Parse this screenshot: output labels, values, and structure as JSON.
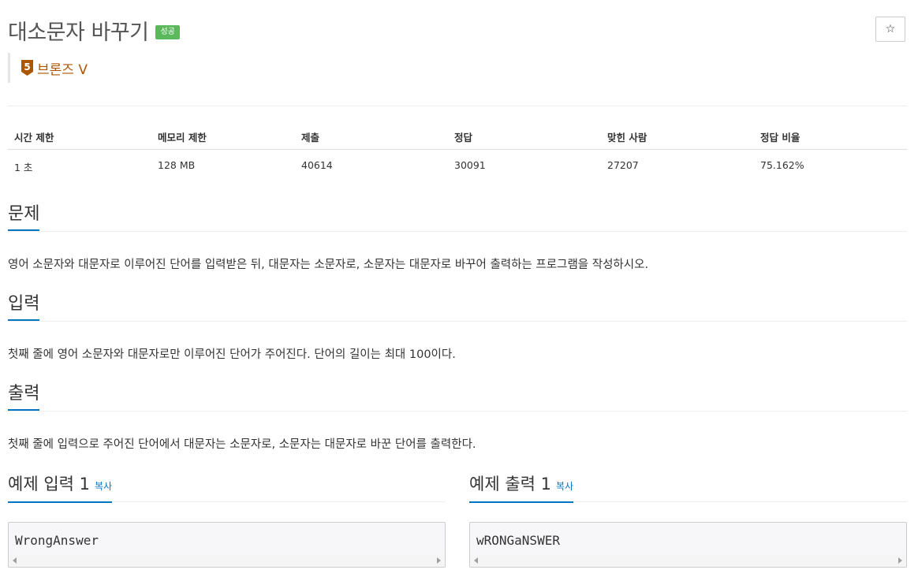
{
  "problem": {
    "title": "대소문자 바꾸기",
    "status_badge": "성공",
    "tier_number": "5",
    "tier_label": "브론즈 V",
    "star_icon": "☆"
  },
  "info": {
    "headers": [
      "시간 제한",
      "메모리 제한",
      "제출",
      "정답",
      "맞힌 사람",
      "정답 비율"
    ],
    "values": [
      "1 초",
      "128 MB",
      "40614",
      "30091",
      "27207",
      "75.162%"
    ]
  },
  "sections": {
    "description": {
      "heading": "문제",
      "text": "영어 소문자와 대문자로 이루어진 단어를 입력받은 뒤, 대문자는 소문자로, 소문자는 대문자로 바꾸어 출력하는 프로그램을 작성하시오."
    },
    "input": {
      "heading": "입력",
      "text": "첫째 줄에 영어 소문자와 대문자로만 이루어진 단어가 주어진다. 단어의 길이는 최대 100이다."
    },
    "output": {
      "heading": "출력",
      "text": "첫째 줄에 입력으로 주어진 단어에서 대문자는 소문자로, 소문자는 대문자로 바꾼 단어를 출력한다."
    }
  },
  "samples": {
    "input": {
      "heading": "예제 입력 1",
      "copy_label": "복사",
      "content": "WrongAnswer"
    },
    "output": {
      "heading": "예제 출력 1",
      "copy_label": "복사",
      "content": "wRONGaNSWER"
    }
  },
  "colors": {
    "tier_bronze": "#ad5600",
    "success_green": "#5cb85c",
    "accent_blue": "#0076c0"
  }
}
